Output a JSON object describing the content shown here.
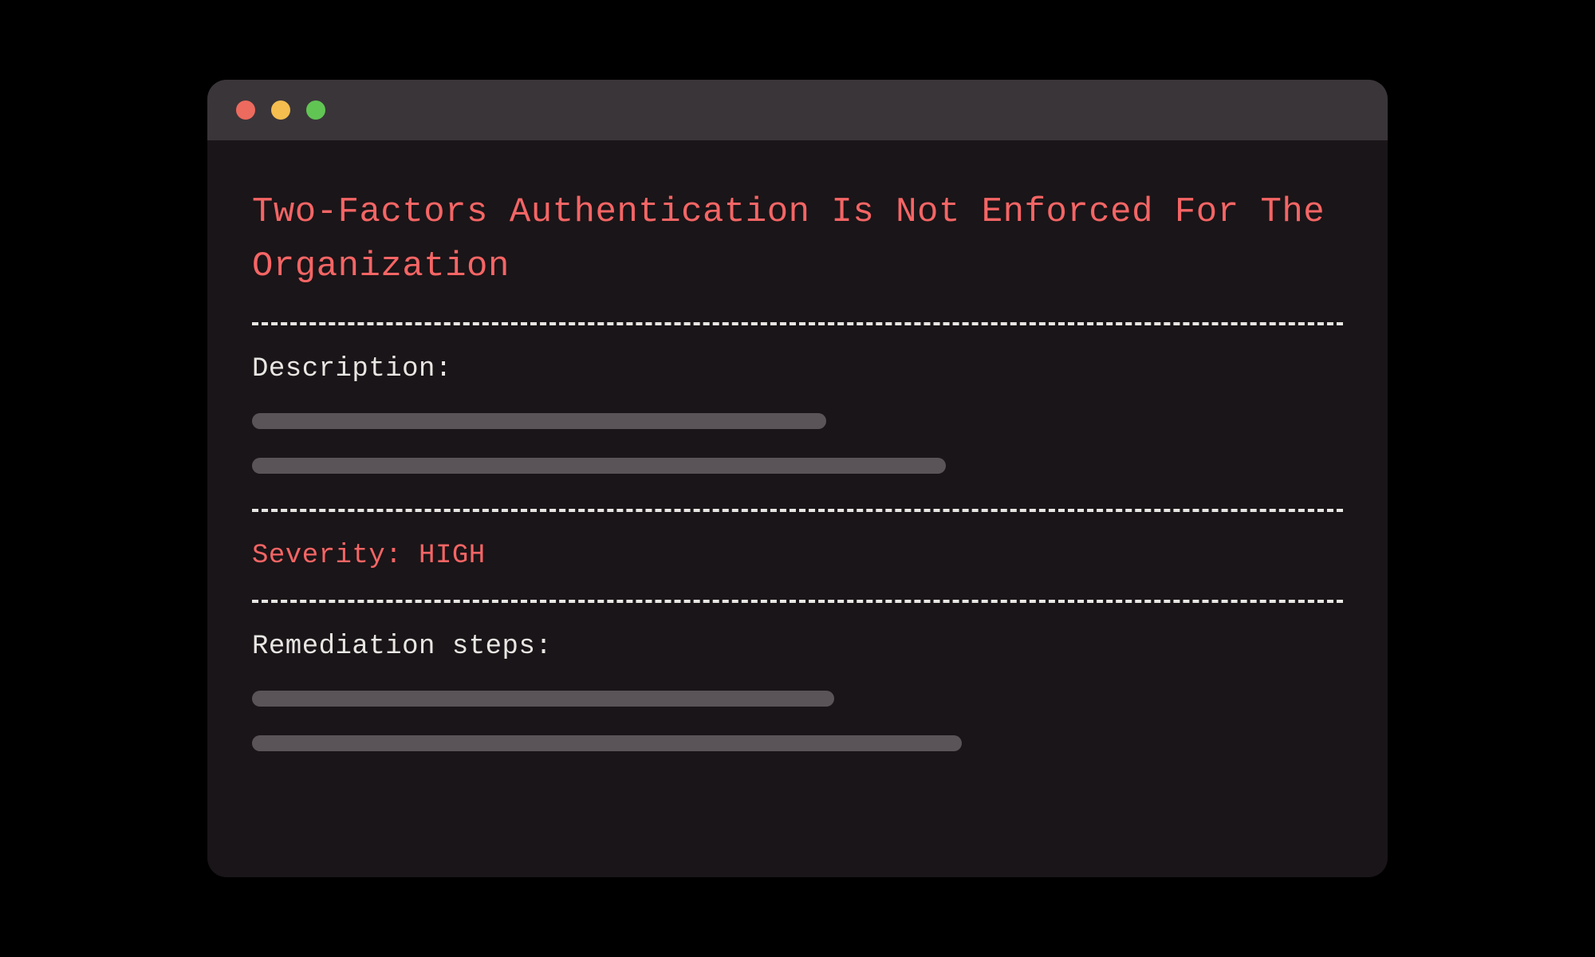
{
  "window": {
    "title": "Two-Factors Authentication Is Not Enforced For The Organization",
    "sections": {
      "description_label": "Description:",
      "severity_label": "Severity:",
      "severity_value": "HIGH",
      "remediation_label": "Remediation steps:"
    }
  }
}
